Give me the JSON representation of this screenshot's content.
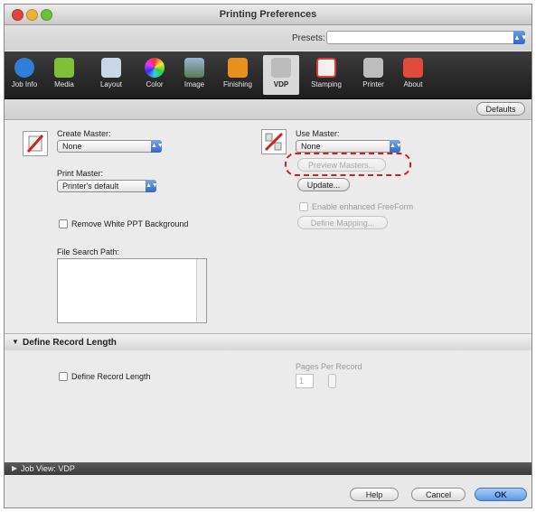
{
  "window": {
    "title": "Printing Preferences"
  },
  "presets": {
    "label": "Presets:",
    "value": ""
  },
  "toolbar": {
    "items": [
      {
        "label": "Job Info",
        "icon": "info-icon",
        "color": "#2f7fd9"
      },
      {
        "label": "Media",
        "icon": "media-icon",
        "color": "#7fbf3a"
      },
      {
        "label": "Layout",
        "icon": "layout-icon",
        "color": "#c9d6e8"
      },
      {
        "label": "Color",
        "icon": "color-wheel-icon",
        "color": "#d94c9a"
      },
      {
        "label": "Image",
        "icon": "image-icon",
        "color": "#8aa6c8"
      },
      {
        "label": "Finishing",
        "icon": "finishing-icon",
        "color": "#e8901e"
      },
      {
        "label": "VDP",
        "icon": "vdp-icon",
        "color": "#cfcfcf"
      },
      {
        "label": "Stamping",
        "icon": "stamping-icon",
        "color": "#d84040"
      },
      {
        "label": "Printer",
        "icon": "printer-icon",
        "color": "#bdbdbd"
      },
      {
        "label": "About",
        "icon": "about-icon",
        "color": "#e04a3a"
      }
    ],
    "active": "VDP"
  },
  "subbar": {
    "defaults_label": "Defaults"
  },
  "vdp": {
    "create_master_label": "Create Master:",
    "create_master_value": "None",
    "print_master_label": "Print Master:",
    "print_master_value": "Printer's default",
    "remove_white_label": "Remove White PPT Background",
    "file_search_label": "File Search Path:",
    "use_master_label": "Use Master:",
    "use_master_value": "None",
    "preview_masters_label": "Preview Masters...",
    "update_label": "Update...",
    "enhanced_freeform_label": "Enable enhanced FreeForm",
    "define_mapping_label": "Define Mapping..."
  },
  "record_length": {
    "section_title": "Define Record Length",
    "checkbox_label": "Define Record Length",
    "pages_per_record_label": "Pages Per Record",
    "pages_per_record_value": "1"
  },
  "jobview": {
    "title": "Job View: VDP"
  },
  "footer": {
    "help_label": "Help",
    "cancel_label": "Cancel",
    "ok_label": "OK"
  },
  "colors": {
    "highlight": "#d21f1f",
    "accent": "#3269c6"
  }
}
